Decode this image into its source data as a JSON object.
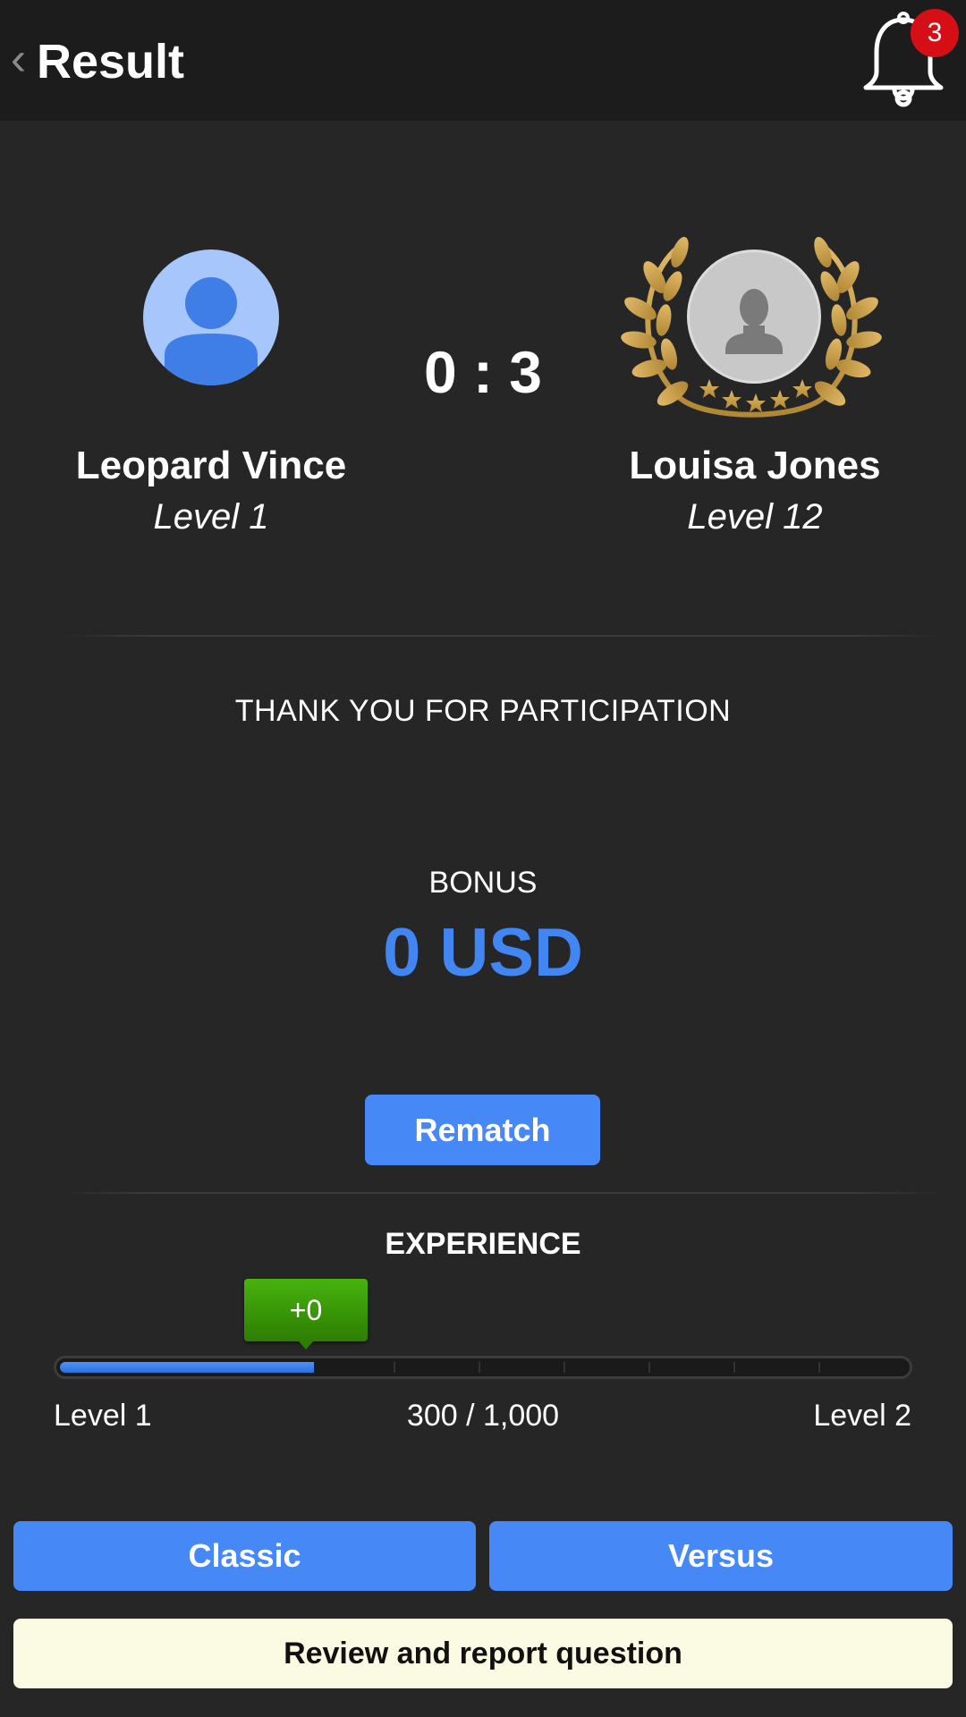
{
  "header": {
    "back_glyph": "‹",
    "title": "Result",
    "notification_count": "3"
  },
  "match": {
    "player": {
      "name": "Leopard Vince",
      "level": "Level 1"
    },
    "opponent": {
      "name": "Louisa Jones",
      "level": "Level 12"
    },
    "score": "0 : 3"
  },
  "message": "THANK YOU FOR PARTICIPATION",
  "bonus": {
    "label": "BONUS",
    "value": "0 USD"
  },
  "rematch_label": "Rematch",
  "experience": {
    "title": "EXPERIENCE",
    "gain": "+0",
    "progress_text": "300 / 1,000",
    "progress_fraction": 0.3,
    "level_start": "Level 1",
    "level_end": "Level 2"
  },
  "modes": {
    "classic_label": "Classic",
    "versus_label": "Versus"
  },
  "review_label": "Review and report question",
  "colors": {
    "accent": "#4688f5",
    "bonus": "#4286f4",
    "badge": "#d50f15",
    "gain": "#3a9a08",
    "review_bg": "#fbfbe3"
  },
  "icons": {
    "back": "chevron-left-icon",
    "notifications": "bell-icon",
    "player_avatar": "user-avatar-icon",
    "opponent_avatar": "user-silhouette-icon",
    "winner": "laurel-wreath-icon"
  }
}
